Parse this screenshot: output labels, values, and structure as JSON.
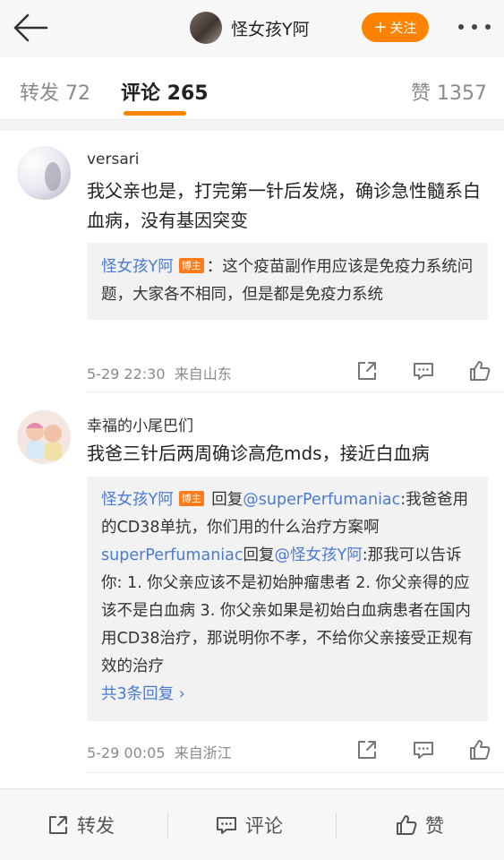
{
  "header": {
    "title": "怪女孩Y阿",
    "follow_label": "关注"
  },
  "tabs": [
    {
      "label": "转发 72"
    },
    {
      "label": "评论 265"
    },
    {
      "label": "赞 1357"
    }
  ],
  "comments": [
    {
      "username": "versari",
      "text": "我父亲也是，打完第一针后发烧，确诊急性髓系白血病，没有基因突变",
      "replies": [
        {
          "author": "怪女孩Y阿",
          "badge": "博主",
          "text": "：这个疫苗副作用应该是免疫力系统问题，大家各不相同，但是都是免疫力系统"
        }
      ],
      "time": "5-29 22:30",
      "source": "来自山东"
    },
    {
      "username": "幸福的小尾巴们",
      "text": "我爸三针后两周确诊高危mds，接近白血病",
      "replies": [
        {
          "author": "怪女孩Y阿",
          "badge": "博主",
          "reply_word": " 回复",
          "mention": "@superPerfumaniac",
          "text": ":我爸爸用的CD38单抗，你们用的什么治疗方案啊"
        },
        {
          "author": "superPerfumaniac",
          "reply_word": "回复",
          "mention": "@怪女孩Y阿",
          "text": ":那我可以告诉你: 1. 你父亲应该不是初始肿瘤患者 2. 你父亲得的应该不是白血病 3. 你父亲如果是初始白血病患者在国内用CD38治疗，那说明你不孝，不给你父亲接受正规有效的治疗"
        }
      ],
      "more_replies": "共3条回复 ›",
      "time": "5-29 00:05",
      "source": "来自浙江"
    }
  ],
  "bottom_bar": {
    "repost_label": "转发",
    "comment_label": "评论",
    "like_label": "赞"
  },
  "colors": {
    "accent": "#ff8200",
    "link": "#4a7bd3",
    "badge": "#ff7b1a"
  }
}
